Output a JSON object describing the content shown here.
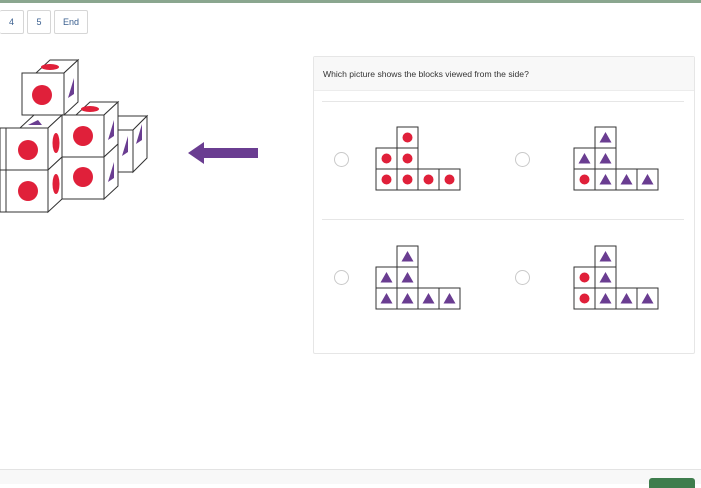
{
  "pager": {
    "items": [
      "4",
      "5",
      "End"
    ]
  },
  "question": {
    "text": "Which picture shows the blocks viewed from the side?"
  },
  "colors": {
    "circle": "#e0203a",
    "triangle": "#6a3d91",
    "arrow": "#6a3d91",
    "top_bar": "#8aa68f",
    "next_button": "#3f7d4d"
  },
  "options": [
    {
      "name": "option-a",
      "grid": [
        [
          "",
          "circle",
          "",
          ""
        ],
        [
          "circle",
          "circle",
          "",
          ""
        ],
        [
          "circle",
          "circle",
          "circle",
          "circle"
        ]
      ]
    },
    {
      "name": "option-b",
      "grid": [
        [
          "",
          "triangle",
          "",
          ""
        ],
        [
          "triangle",
          "triangle",
          "",
          ""
        ],
        [
          "circle",
          "triangle",
          "triangle",
          "triangle"
        ]
      ]
    },
    {
      "name": "option-c",
      "grid": [
        [
          "",
          "triangle",
          "",
          ""
        ],
        [
          "triangle",
          "triangle",
          "",
          ""
        ],
        [
          "triangle",
          "triangle",
          "triangle",
          "triangle"
        ]
      ]
    },
    {
      "name": "option-d",
      "grid": [
        [
          "",
          "triangle",
          "",
          ""
        ],
        [
          "circle",
          "triangle",
          "",
          ""
        ],
        [
          "circle",
          "triangle",
          "triangle",
          "triangle"
        ]
      ]
    }
  ]
}
